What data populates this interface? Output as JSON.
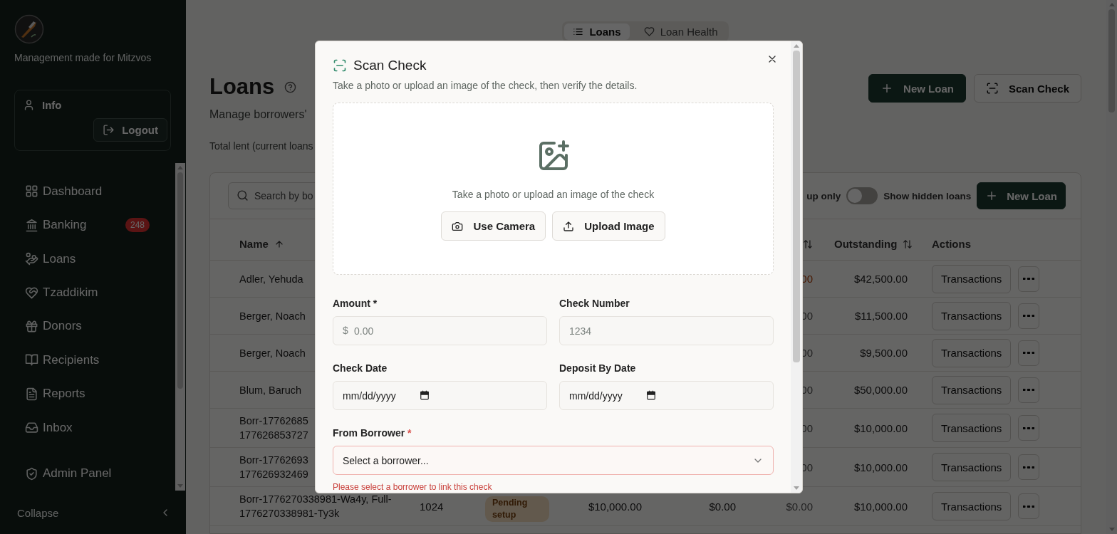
{
  "sidebar": {
    "tagline": "Management made for Mitzvos",
    "user": {
      "label": "Info"
    },
    "logout": "Logout",
    "nav": [
      {
        "label": "Dashboard"
      },
      {
        "label": "Banking",
        "badge": "248"
      },
      {
        "label": "Loans"
      },
      {
        "label": "Tzaddikim"
      },
      {
        "label": "Donors"
      },
      {
        "label": "Recipients"
      },
      {
        "label": "Reports"
      },
      {
        "label": "Inbox"
      }
    ],
    "admin": {
      "label": "Admin Panel"
    },
    "collapse": "Collapse"
  },
  "tabs": [
    {
      "label": "Loans",
      "selected": true
    },
    {
      "label": "Loan Health",
      "selected": false
    }
  ],
  "header": {
    "title": "Loans",
    "subtitle": "Manage borrowers'",
    "summary": "Total lent (current loans",
    "buttons": [
      {
        "label": "New Loan",
        "kind": "primary"
      },
      {
        "label": "Scan Check",
        "kind": "outline"
      }
    ]
  },
  "toolbar": {
    "search_placeholder": "Search by bo",
    "filter_label": "up only",
    "toggle": {
      "label": "Show hidden loans",
      "on": false
    },
    "button": "New Loan"
  },
  "table": {
    "columns": {
      "name": {
        "label": "Name",
        "sorted": true
      },
      "column_6": {
        "sorted": false
      },
      "outstanding": {
        "label": "Outstanding",
        "sorted": false
      },
      "actions": {
        "label": "Actions"
      }
    },
    "rows": [
      {
        "name": "Adler, Yehuda",
        "column_6": {
          "text": "00",
          "kind": "warning"
        },
        "outstanding": "$42,500.00",
        "action": "Transactions"
      },
      {
        "name": "Berger, Noach",
        "column_6": {
          "text": "00",
          "kind": "muted"
        },
        "outstanding": "$11,500.00",
        "action": "Transactions"
      },
      {
        "name": "Berger, Noach",
        "column_6": {
          "text": "00",
          "kind": "muted"
        },
        "outstanding": "$9,500.00",
        "action": "Transactions"
      },
      {
        "name": "Blum, Baruch",
        "column_6": {
          "text": "00",
          "kind": "muted"
        },
        "outstanding": "$50,000.00",
        "action": "Transactions"
      },
      {
        "name": "Borr-17762685\n177626853727",
        "column_6": {
          "text": "00",
          "kind": "muted"
        },
        "outstanding": "$10,000.00",
        "action": "Transactions"
      },
      {
        "name": "Borr-17762693\n177626932469",
        "column_6": {
          "text": "00",
          "kind": "muted"
        },
        "outstanding": "$10,000.00",
        "action": "Transactions"
      },
      {
        "name": "Borr-1776270338981-Wa4y, Full-\n1776270338981-Ty3k",
        "column_2": "1024",
        "status": {
          "label": "Pending\nsetup",
          "kind": "pending"
        },
        "column_4": "$10,000.00",
        "column_5": "$0.00",
        "column_6": {
          "text": "$0.00",
          "kind": "muted"
        },
        "outstanding": "$10,000.00",
        "action": "Transactions"
      }
    ]
  },
  "dialog": {
    "title": "Scan Check",
    "subtitle": "Take a photo or upload an image of the check, then verify the details.",
    "dropzone": {
      "prompt": "Take a photo or upload an image of the check",
      "buttons": [
        {
          "label": "Use Camera",
          "kind": "camera"
        },
        {
          "label": "Upload Image",
          "kind": "upload"
        }
      ]
    },
    "fields": [
      {
        "label": "Amount",
        "required_mark": "*",
        "kind": "amount",
        "prefix": "$",
        "placeholder": "0.00"
      },
      {
        "label": "Check Number",
        "kind": "text",
        "placeholder": "1234"
      },
      {
        "label": "Check Date",
        "kind": "date",
        "placeholder": "mm/dd/yyyy"
      },
      {
        "label": "Deposit By Date",
        "kind": "date",
        "placeholder": "mm/dd/yyyy"
      }
    ],
    "borrower": {
      "label": "From Borrower",
      "required_mark": "*",
      "value": "Select a borrower...",
      "invalid": true,
      "error": "Please select a borrower to link this check"
    }
  }
}
